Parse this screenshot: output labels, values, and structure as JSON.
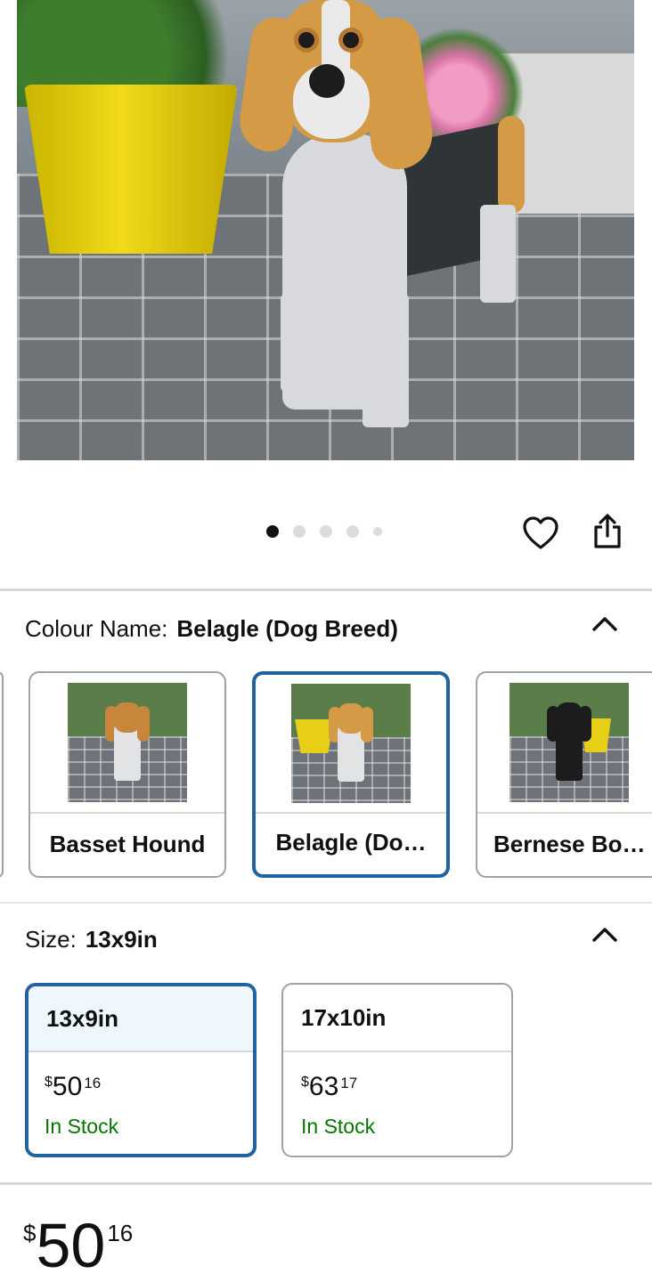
{
  "product_gallery": {
    "image_subject": "beagle-dog-planter",
    "page_count": 5,
    "current_index": 0
  },
  "actions": {
    "wishlist_icon": "heart-icon",
    "share_icon": "share-icon"
  },
  "colour": {
    "label": "Colour Name:",
    "selected_value": "Belagle (Dog Breed)",
    "options": [
      {
        "label": "Basset Hound",
        "selected": false,
        "ear_color": "#c7863c",
        "head_color": "#c7863c"
      },
      {
        "label": "Belagle (Do…",
        "selected": true,
        "ear_color": "#d49a45",
        "head_color": "#d49a45"
      },
      {
        "label": "Bernese Bo…",
        "selected": false,
        "ear_color": "#1c1c1c",
        "head_color": "#1c1c1c"
      }
    ]
  },
  "size": {
    "label": "Size:",
    "selected_value": "13x9in",
    "options": [
      {
        "label": "13x9in",
        "currency": "$",
        "whole": "50",
        "fraction": "16",
        "stock": "In Stock",
        "selected": true
      },
      {
        "label": "17x10in",
        "currency": "$",
        "whole": "63",
        "fraction": "17",
        "stock": "In Stock",
        "selected": false
      }
    ]
  },
  "price": {
    "currency": "$",
    "whole": "50",
    "fraction": "16"
  },
  "colors": {
    "selected_border": "#2162a1",
    "in_stock": "#007600",
    "selected_header_bg": "#edf7fc"
  }
}
